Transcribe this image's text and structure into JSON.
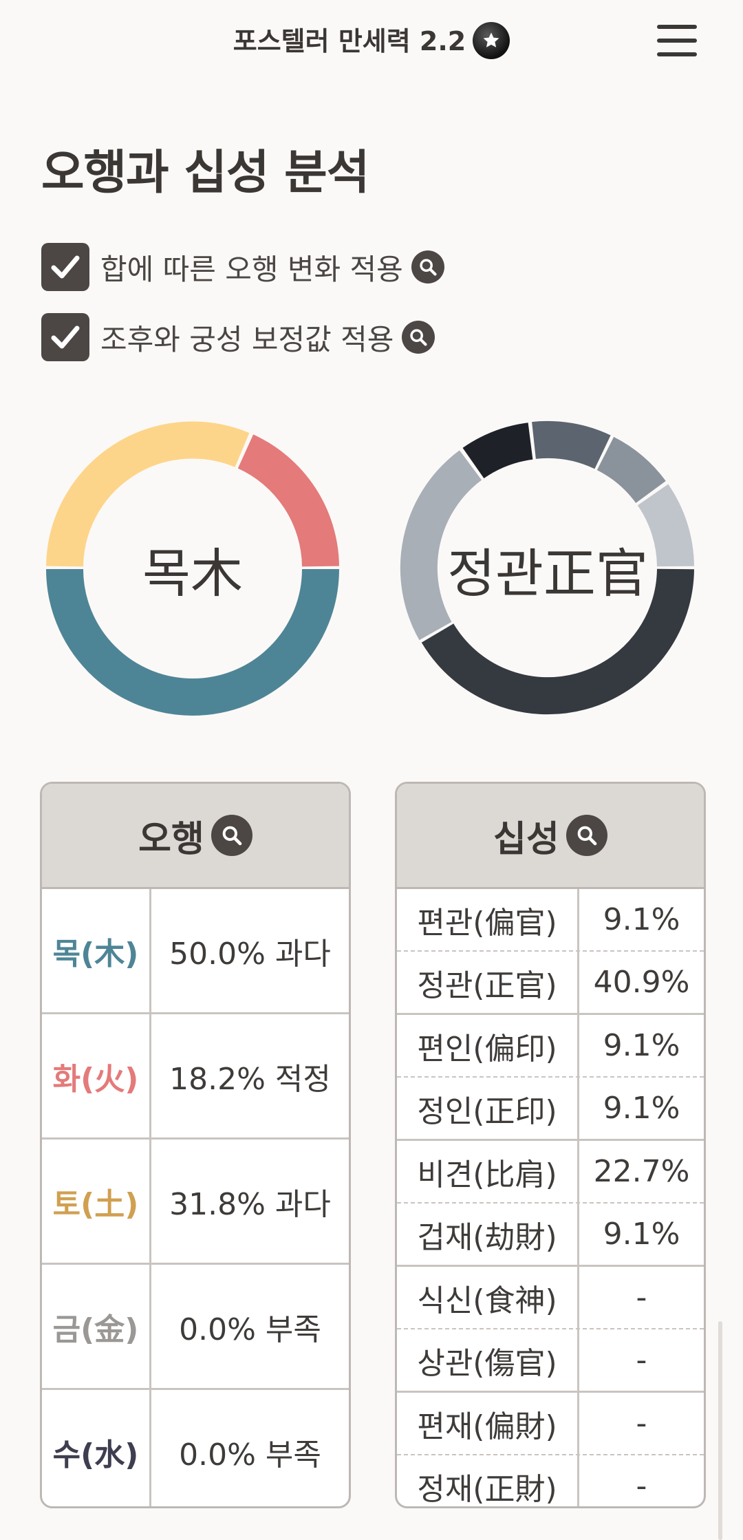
{
  "header": {
    "app_title": "포스텔러 만세력 2.2"
  },
  "page": {
    "title": "오행과 십성 분석"
  },
  "options": [
    {
      "label": "합에 따른 오행 변화 적용",
      "checked": true
    },
    {
      "label": "조후와 궁성 보정값 적용",
      "checked": true
    }
  ],
  "donuts": {
    "elements_center": "목木",
    "ten_gods_center": "정관正官"
  },
  "colors": {
    "wood": "#4e8596",
    "fire": "#e47a7a",
    "earth": "#d0a050",
    "earth_ring": "#fdd58a",
    "metal": "#9a9795",
    "water": "#3e3e50"
  },
  "elements_table": {
    "header": "오행",
    "rows": [
      {
        "key": "목(木)",
        "value": "50.0% 과다"
      },
      {
        "key": "화(火)",
        "value": "18.2% 적정"
      },
      {
        "key": "토(土)",
        "value": "31.8% 과다"
      },
      {
        "key": "금(金)",
        "value": "0.0% 부족"
      },
      {
        "key": "수(水)",
        "value": "0.0% 부족"
      }
    ]
  },
  "ten_gods_table": {
    "header": "십성",
    "rows": [
      {
        "key": "편관(偏官)",
        "value": "9.1%"
      },
      {
        "key": "정관(正官)",
        "value": "40.9%"
      },
      {
        "key": "편인(偏印)",
        "value": "9.1%"
      },
      {
        "key": "정인(正印)",
        "value": "9.1%"
      },
      {
        "key": "비견(比肩)",
        "value": "22.7%"
      },
      {
        "key": "겁재(劫財)",
        "value": "9.1%"
      },
      {
        "key": "식신(食神)",
        "value": "-"
      },
      {
        "key": "상관(傷官)",
        "value": "-"
      },
      {
        "key": "편재(偏財)",
        "value": "-"
      },
      {
        "key": "정재(正財)",
        "value": "-"
      }
    ]
  },
  "icons": {
    "badge": "star-badge-icon",
    "menu": "hamburger-menu-icon",
    "help": "magnifier-icon",
    "check": "checkmark-icon"
  }
}
